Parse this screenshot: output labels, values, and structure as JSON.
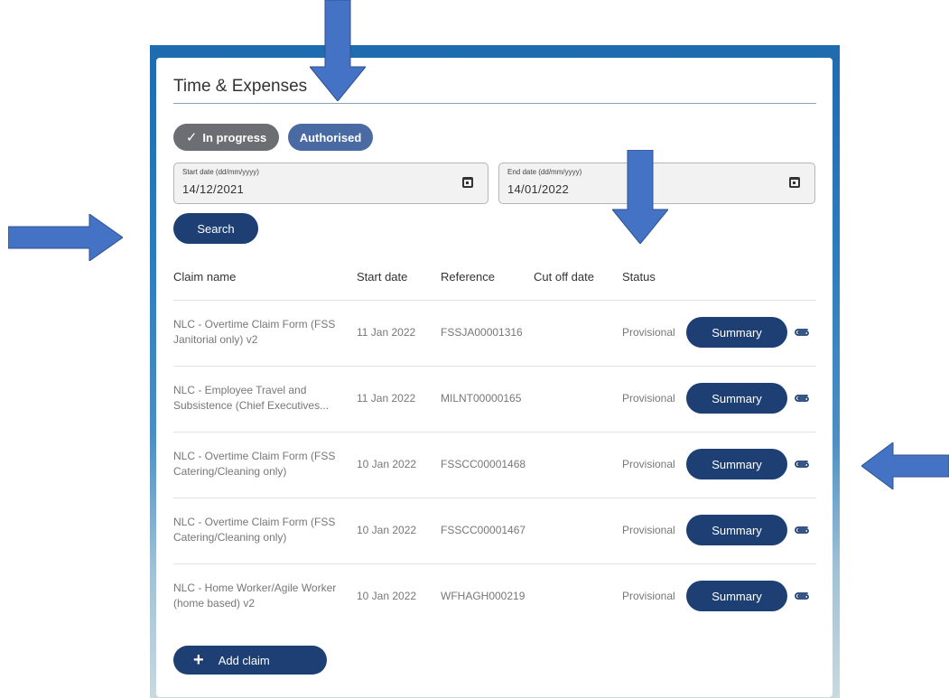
{
  "page": {
    "title": "Time & Expenses"
  },
  "filters": {
    "in_progress_label": "In progress",
    "authorised_label": "Authorised",
    "start_date_label": "Start date (dd/mm/yyyy)",
    "start_date_value": "14/12/2021",
    "end_date_label": "End date (dd/mm/yyyy)",
    "end_date_value": "14/01/2022",
    "search_label": "Search"
  },
  "table": {
    "headers": [
      "Claim name",
      "Start date",
      "Reference",
      "Cut off date",
      "Status"
    ],
    "rows": [
      {
        "name": "NLC - Overtime Claim Form (FSS Janitorial only) v2",
        "start": "11 Jan 2022",
        "reference": "FSSJA00001316",
        "cutoff": "",
        "status": "Provisional",
        "action": "Summary"
      },
      {
        "name": "NLC - Employee Travel and Subsistence (Chief Executives...",
        "start": "11 Jan 2022",
        "reference": "MILNT00000165",
        "cutoff": "",
        "status": "Provisional",
        "action": "Summary"
      },
      {
        "name": "NLC - Overtime Claim Form (FSS Catering/Cleaning only)",
        "start": "10 Jan 2022",
        "reference": "FSSCC00001468",
        "cutoff": "",
        "status": "Provisional",
        "action": "Summary"
      },
      {
        "name": "NLC - Overtime Claim Form (FSS Catering/Cleaning only)",
        "start": "10 Jan 2022",
        "reference": "FSSCC00001467",
        "cutoff": "",
        "status": "Provisional",
        "action": "Summary"
      },
      {
        "name": "NLC - Home Worker/Agile Worker (home based) v2",
        "start": "10 Jan 2022",
        "reference": "WFHAGH000219",
        "cutoff": "",
        "status": "Provisional",
        "action": "Summary"
      }
    ]
  },
  "footer": {
    "add_claim_label": "Add claim"
  },
  "colors": {
    "primary": "#1d3f73",
    "in_progress_chip": "#6b6f73",
    "authorised_chip": "#4a6aa3",
    "annotation_arrow": "#4472c4"
  },
  "icons": {
    "date_picker": "calendar-icon",
    "attachment": "paperclip-icon",
    "chip_check": "check-icon",
    "add": "plus-icon"
  }
}
